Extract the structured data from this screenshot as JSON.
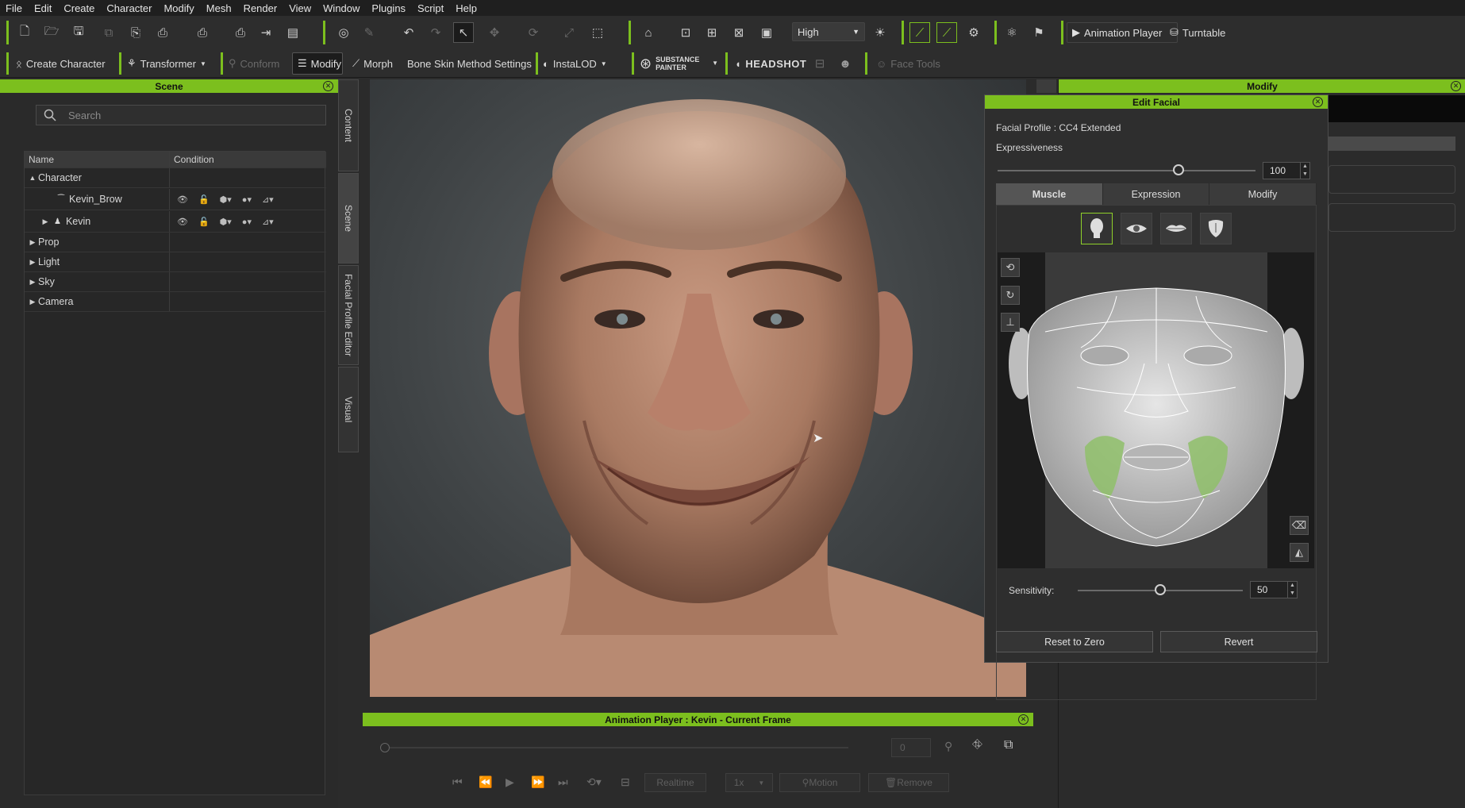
{
  "menu": [
    "File",
    "Edit",
    "Create",
    "Character",
    "Modify",
    "Mesh",
    "Render",
    "View",
    "Window",
    "Plugins",
    "Script",
    "Help"
  ],
  "toolbar1": {
    "quality_value": "High",
    "animation_player_label": "Animation Player",
    "turntable_label": "Turntable"
  },
  "toolbar2": {
    "create_character": "Create Character",
    "transformer": "Transformer",
    "conform": "Conform",
    "modify": "Modify",
    "morph": "Morph",
    "bone_skin": "Bone Skin Method Settings",
    "instalod": "InstaLOD",
    "substance_painter": "SUBSTANCE PAINTER",
    "headshot": "HEADSHOT",
    "face_tools": "Face Tools"
  },
  "scene": {
    "title": "Scene",
    "search_placeholder": "Search",
    "columns": [
      "Name",
      "Condition"
    ],
    "items": [
      {
        "label": "Character",
        "expand": "▲"
      },
      {
        "label": "Kevin_Brow"
      },
      {
        "label": "Kevin",
        "expand": "▶"
      },
      {
        "label": "Prop",
        "expand": "▶"
      },
      {
        "label": "Light",
        "expand": "▶"
      },
      {
        "label": "Sky",
        "expand": "▶"
      },
      {
        "label": "Camera",
        "expand": "▶"
      }
    ]
  },
  "side_tabs": [
    "Content",
    "Scene",
    "Facial Profile Editor",
    "Visual"
  ],
  "modify_panel": {
    "title": "Modify"
  },
  "edit_facial": {
    "title": "Edit Facial",
    "profile": "Facial Profile : CC4 Extended",
    "expressiveness_label": "Expressiveness",
    "expressiveness_value": "100",
    "expressiveness_level": 0.7,
    "tabs": [
      "Muscle",
      "Expression",
      "Modify"
    ],
    "active_tab": "Muscle",
    "sensitivity_label": "Sensitivity:",
    "sensitivity_value": "50",
    "sensitivity_level": 0.5,
    "reset_button": "Reset to Zero",
    "revert_button": "Revert"
  },
  "animation_player": {
    "title": "Animation Player : Kevin - Current Frame",
    "frame_value": "0",
    "realtime": "Realtime",
    "speed": "1x",
    "motion": "Motion",
    "remove": "Remove"
  },
  "colors": {
    "accent": "#7cbf1e",
    "muscle_highlight": "#8fbf6a"
  }
}
